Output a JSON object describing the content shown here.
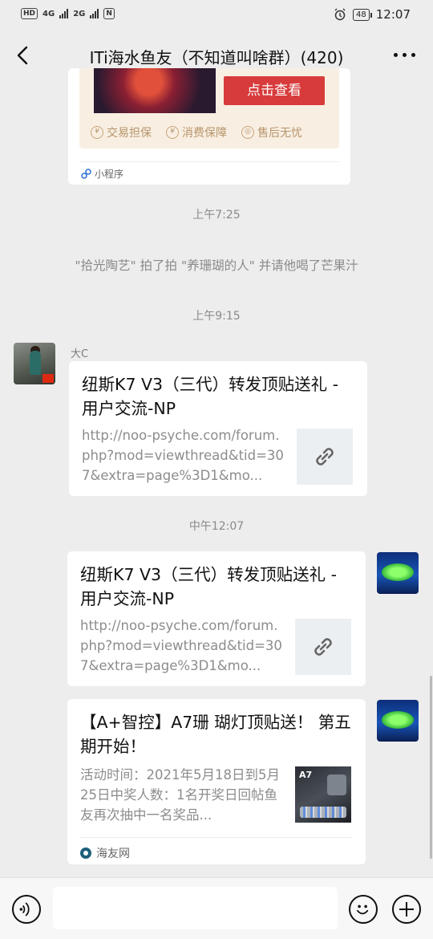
{
  "status_bar": {
    "hd": "HD",
    "net1": "4G",
    "net2": "2G",
    "nfc": "N",
    "battery": "48",
    "time": "12:07"
  },
  "header": {
    "title": "ITi海水鱼友（不知道叫啥群）(420)"
  },
  "mini_program_card": {
    "button_label": "点击查看",
    "guarantees": [
      "交易担保",
      "消费保障",
      "售后无忧"
    ],
    "source_label": "小程序"
  },
  "messages": {
    "time1": "上午7:25",
    "system_notice": "\"拾光陶艺\" 拍了拍 \"养珊瑚的人\" 并请他喝了芒果汁",
    "time2": "上午9:15",
    "sender_name": "大C",
    "card1": {
      "title": "纽斯K7 V3（三代）转发顶贴送礼 - 用户交流-NP",
      "desc": "http://noo-psyche.com/forum.php?mod=viewthread&tid=307&extra=page%3D1&mo..."
    },
    "time3": "中午12:07",
    "card2": {
      "title": "纽斯K7 V3（三代）转发顶贴送礼 - 用户交流-NP",
      "desc": "http://noo-psyche.com/forum.php?mod=viewthread&tid=307&extra=page%3D1&mo..."
    },
    "card3": {
      "title": "【A+智控】A7珊 瑚灯顶贴送！ 第五期开始！",
      "desc": "活动时间：2021年5月18日到5月25日中奖人数：1名开奖日回帖鱼友再次抽中一名奖品...",
      "thumb_text": "A7",
      "source": "海友网"
    }
  },
  "input_bar": {
    "placeholder": ""
  },
  "colors": {
    "background": "#ededed",
    "card": "#ffffff",
    "button_red": "#d83b3b",
    "muted_text": "#8a8a8a"
  },
  "icons": [
    "back-arrow-icon",
    "more-icon",
    "link-icon",
    "voice-icon",
    "emoji-icon",
    "plus-icon",
    "miniprogram-icon"
  ]
}
